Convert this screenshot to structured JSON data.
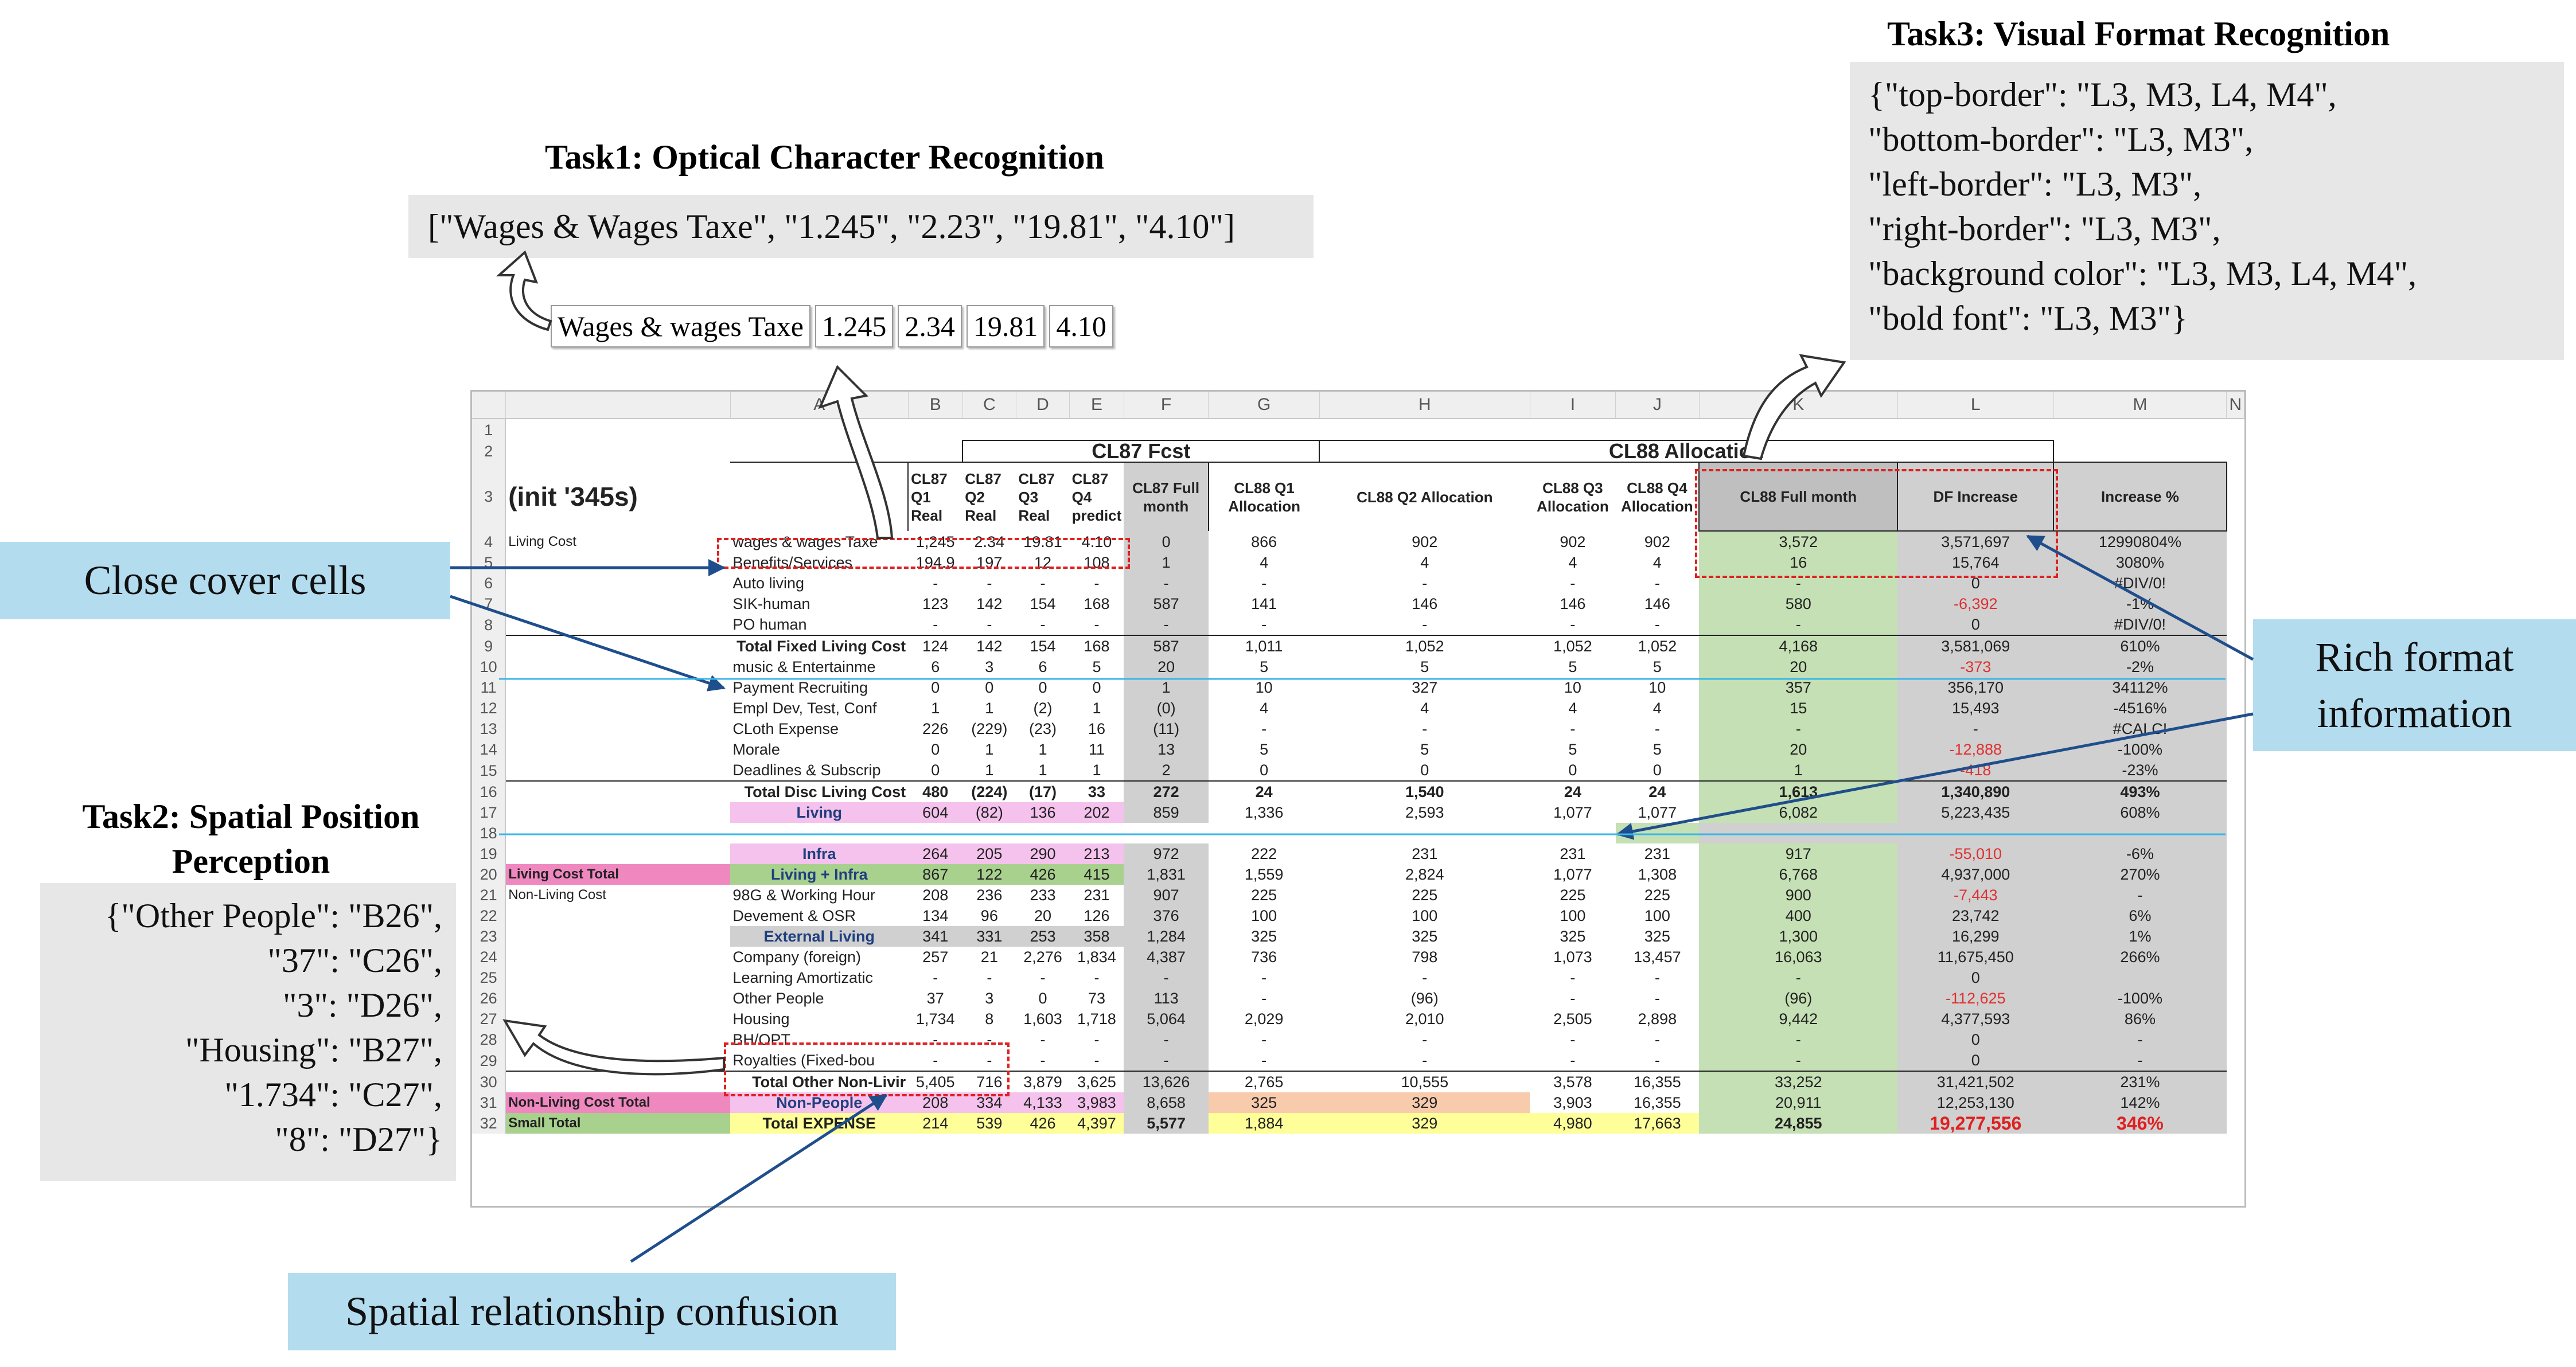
{
  "task1": {
    "title": "Task1: Optical Character Recognition",
    "result": "[\"Wages & Wages Taxe\", \"1.245\", \"2.23\", \"19.81\", \"4.10\"]",
    "crop": [
      "Wages & wages Taxe",
      "1.245",
      "2.34",
      "19.81",
      "4.10"
    ]
  },
  "task2": {
    "title_line1": "Task2: Spatial Position",
    "title_line2": "Perception",
    "lines": [
      "{\"Other People\": \"B26\",",
      "\"37\": \"C26\",",
      "\"3\": \"D26\",",
      "\"Housing\": \"B27\",",
      "\"1.734\": \"C27\",",
      "\"8\": \"D27\"}"
    ]
  },
  "task3": {
    "title": "Task3: Visual Format Recognition",
    "lines": [
      "{\"top-border\": \"L3, M3, L4, M4\",",
      "\"bottom-border\": \"L3, M3\",",
      "\"left-border\": \"L3, M3\",",
      "\"right-border\": \"L3, M3\",",
      "\"background color\": \"L3, M3, L4, M4\",",
      "\"bold font\": \"L3, M3\"}"
    ]
  },
  "callouts": {
    "close_cover": "Close cover cells",
    "rich_format_1": "Rich format",
    "rich_format_2": "information",
    "spatial_confusion": "Spatial relationship confusion"
  },
  "sheet": {
    "columns": [
      "A",
      "B",
      "C",
      "D",
      "E",
      "F",
      "G",
      "H",
      "I",
      "J",
      "K",
      "L",
      "M",
      "N"
    ],
    "title_init": "(init '345s)",
    "cl87_header": "CL87 Fcst",
    "cl88_header": "CL88 Allocation",
    "row3": {
      "c": [
        "CL87",
        "Q1",
        "Real"
      ],
      "d": [
        "CL87",
        "Q2",
        "Real"
      ],
      "e": [
        "CL87",
        "Q3",
        "Real"
      ],
      "f": [
        "CL87",
        "Q4",
        "predict"
      ],
      "g": [
        "CL87 Full",
        "month"
      ],
      "h": [
        "CL88 Q1",
        "Allocation"
      ],
      "i": "CL88 Q2 Allocation",
      "j": [
        "CL88 Q3",
        "Allocation"
      ],
      "k": [
        "CL88 Q4",
        "Allocation"
      ],
      "l": "CL88 Full month",
      "m": "DF Increase",
      "n": "Increase %"
    },
    "rows": [
      {
        "n": "4",
        "a": "Living Cost",
        "b": "wages & wages Taxe",
        "c": "1,245",
        "d": "2.34",
        "e": "19.81",
        "f": "4.10",
        "g": "0",
        "h": "866",
        "i": "902",
        "j": "902",
        "k": "902",
        "l": "3,572",
        "m": "3,571,697",
        "nn": "12990804%"
      },
      {
        "n": "5",
        "a": "",
        "b": "Benefits/Services",
        "c": "194.9",
        "d": "197",
        "e": "12",
        "f": "108",
        "g": "1",
        "h": "4",
        "i": "4",
        "j": "4",
        "k": "4",
        "l": "16",
        "m": "15,764",
        "nn": "3080%"
      },
      {
        "n": "6",
        "a": "",
        "b": "Auto living",
        "c": "-",
        "d": "-",
        "e": "-",
        "f": "-",
        "g": "-",
        "h": "-",
        "i": "-",
        "j": "-",
        "k": "-",
        "l": "-",
        "m": "0",
        "nn": "#DIV/0!"
      },
      {
        "n": "7",
        "a": "",
        "b": "SIK-human",
        "c": "123",
        "d": "142",
        "e": "154",
        "f": "168",
        "g": "587",
        "h": "141",
        "i": "146",
        "j": "146",
        "k": "146",
        "l": "580",
        "m": "-6,392",
        "nn": "-1%",
        "neg": true
      },
      {
        "n": "8",
        "a": "",
        "b": "PO  human",
        "c": "-",
        "d": "-",
        "e": "-",
        "f": "-",
        "g": "-",
        "h": "-",
        "i": "-",
        "j": "-",
        "k": "-",
        "l": "-",
        "m": "0",
        "nn": "#DIV/0!"
      },
      {
        "n": "9",
        "a": "",
        "b": "Total Fixed Living Cost",
        "c": "124",
        "d": "142",
        "e": "154",
        "f": "168",
        "g": "587",
        "h": "1,011",
        "i": "1,052",
        "j": "1,052",
        "k": "1,052",
        "l": "4,168",
        "m": "3,581,069",
        "nn": "610%",
        "total": true
      },
      {
        "n": "10",
        "a": "",
        "b": "music & Entertainme",
        "c": "6",
        "d": "3",
        "e": "6",
        "f": "5",
        "g": "20",
        "h": "5",
        "i": "5",
        "j": "5",
        "k": "5",
        "l": "20",
        "m": "-373",
        "nn": "-2%",
        "neg": true
      },
      {
        "n": "11",
        "a": "",
        "b": "Payment Recruiting",
        "c": "0",
        "d": "0",
        "e": "0",
        "f": "0",
        "g": "1",
        "h": "10",
        "i": "327",
        "j": "10",
        "k": "10",
        "l": "357",
        "m": "356,170",
        "nn": "34112%"
      },
      {
        "n": "12",
        "a": "",
        "b": "Empl Dev, Test, Conf",
        "c": "1",
        "d": "1",
        "e": "(2)",
        "f": "1",
        "g": "(0)",
        "h": "4",
        "i": "4",
        "j": "4",
        "k": "4",
        "l": "15",
        "m": "15,493",
        "nn": "-4516%"
      },
      {
        "n": "13",
        "a": "",
        "b": "CLoth Expense",
        "c": "226",
        "d": "(229)",
        "e": "(23)",
        "f": "16",
        "g": "(11)",
        "h": "-",
        "i": "-",
        "j": "-",
        "k": "-",
        "l": "-",
        "m": "-",
        "nn": "#CALC!"
      },
      {
        "n": "14",
        "a": "",
        "b": "Morale",
        "c": "0",
        "d": "1",
        "e": "1",
        "f": "11",
        "g": "13",
        "h": "5",
        "i": "5",
        "j": "5",
        "k": "5",
        "l": "20",
        "m": "-12,888",
        "nn": "-100%",
        "neg": true
      },
      {
        "n": "15",
        "a": "",
        "b": "Deadlines & Subscrip",
        "c": "0",
        "d": "1",
        "e": "1",
        "f": "1",
        "g": "2",
        "h": "0",
        "i": "0",
        "j": "0",
        "k": "0",
        "l": "1",
        "m": "-418",
        "nn": "-23%",
        "neg": true
      },
      {
        "n": "16",
        "a": "",
        "b": "Total Disc Living Cost",
        "c": "480",
        "d": "(224)",
        "e": "(17)",
        "f": "33",
        "g": "272",
        "h": "24",
        "i": "1,540",
        "j": "24",
        "k": "24",
        "l": "1,613",
        "m": "1,340,890",
        "nn": "493%",
        "total": true,
        "boldnums": true
      },
      {
        "n": "17",
        "a": "",
        "b": "Living",
        "c": "604",
        "d": "(82)",
        "e": "136",
        "f": "202",
        "g": "859",
        "h": "1,336",
        "i": "2,593",
        "j": "1,077",
        "k": "1,077",
        "l": "6,082",
        "m": "5,223,435",
        "nn": "608%",
        "pink": true
      },
      {
        "n": "18",
        "blank": true
      },
      {
        "n": "19",
        "a": "",
        "b": "Infra",
        "c": "264",
        "d": "205",
        "e": "290",
        "f": "213",
        "g": "972",
        "h": "222",
        "i": "231",
        "j": "231",
        "k": "231",
        "l": "917",
        "m": "-55,010",
        "nn": "-6%",
        "pink": true,
        "neg": true
      },
      {
        "n": "20",
        "a": "Living Cost Total",
        "b": "Living + Infra",
        "c": "867",
        "d": "122",
        "e": "426",
        "f": "415",
        "g": "1,831",
        "h": "1,559",
        "i": "2,824",
        "j": "1,077",
        "k": "1,308",
        "l": "6,768",
        "m": "4,937,000",
        "nn": "270%",
        "greenrow": true
      },
      {
        "n": "21",
        "a": "Non-Living Cost",
        "b": "98G & Working Hour",
        "c": "208",
        "d": "236",
        "e": "233",
        "f": "231",
        "g": "907",
        "h": "225",
        "i": "225",
        "j": "225",
        "k": "225",
        "l": "900",
        "m": "-7,443",
        "nn": "-",
        "neg": true
      },
      {
        "n": "22",
        "a": "",
        "b": "Devement & OSR",
        "c": "134",
        "d": "96",
        "e": "20",
        "f": "126",
        "g": "376",
        "h": "100",
        "i": "100",
        "j": "100",
        "k": "100",
        "l": "400",
        "m": "23,742",
        "nn": "6%"
      },
      {
        "n": "23",
        "a": "",
        "b": "External Living",
        "c": "341",
        "d": "331",
        "e": "253",
        "f": "358",
        "g": "1,284",
        "h": "325",
        "i": "325",
        "j": "325",
        "k": "325",
        "l": "1,300",
        "m": "16,299",
        "nn": "1%",
        "grayrow": true
      },
      {
        "n": "24",
        "a": "",
        "b": "Company (foreign)",
        "c": "257",
        "d": "21",
        "e": "2,276",
        "f": "1,834",
        "g": "4,387",
        "h": "736",
        "i": "798",
        "j": "1,073",
        "k": "13,457",
        "l": "16,063",
        "m": "11,675,450",
        "nn": "266%"
      },
      {
        "n": "25",
        "a": "",
        "b": "Learning Amortizatic",
        "c": "-",
        "d": "-",
        "e": "-",
        "f": "-",
        "g": "-",
        "h": "-",
        "i": "-",
        "j": "-",
        "k": "-",
        "l": "-",
        "m": "0",
        "nn": ""
      },
      {
        "n": "26",
        "a": "",
        "b": "Other People",
        "c": "37",
        "d": "3",
        "e": "0",
        "f": "73",
        "g": "113",
        "h": "-",
        "i": "(96)",
        "j": "-",
        "k": "-",
        "l": "(96)",
        "m": "-112,625",
        "nn": "-100%",
        "neg": true
      },
      {
        "n": "27",
        "a": "",
        "b": "Housing",
        "c": "1,734",
        "d": "8",
        "e": "1,603",
        "f": "1,718",
        "g": "5,064",
        "h": "2,029",
        "i": "2,010",
        "j": "2,505",
        "k": "2,898",
        "l": "9,442",
        "m": "4,377,593",
        "nn": "86%"
      },
      {
        "n": "28",
        "a": "",
        "b": "BH/OPT",
        "c": "-",
        "d": "-",
        "e": "-",
        "f": "-",
        "g": "-",
        "h": "-",
        "i": "-",
        "j": "-",
        "k": "-",
        "l": "-",
        "m": "0",
        "nn": "-"
      },
      {
        "n": "29",
        "a": "",
        "b": "Royalties (Fixed-bou",
        "c": "-",
        "d": "-",
        "e": "-",
        "f": "-",
        "g": "-",
        "h": "-",
        "i": "-",
        "j": "-",
        "k": "-",
        "l": "-",
        "m": "0",
        "nn": "-"
      },
      {
        "n": "30",
        "a": "",
        "b": "Total Other Non-Livir",
        "c": "5,405",
        "d": "716",
        "e": "3,879",
        "f": "3,625",
        "g": "13,626",
        "h": "2,765",
        "i": "10,555",
        "j": "3,578",
        "k": "16,355",
        "l": "33,252",
        "m": "31,421,502",
        "nn": "231%",
        "total": true
      },
      {
        "n": "31",
        "a": "Non-Living Cost Total",
        "b": "Non-People",
        "c": "208",
        "d": "334",
        "e": "4,133",
        "f": "3,983",
        "g": "8,658",
        "h": "325",
        "i": "329",
        "j": "3,903",
        "k": "16,355",
        "l": "20,911",
        "m": "12,253,130",
        "nn": "142%",
        "orangerow": true
      },
      {
        "n": "32",
        "a": "Small Total",
        "b": "Total EXPENSE",
        "c": "214",
        "d": "539",
        "e": "426",
        "f": "4,397",
        "g": "5,577",
        "h": "1,884",
        "i": "329",
        "j": "4,980",
        "k": "17,663",
        "l": "24,855",
        "m": "19,277,556",
        "nn": "346%",
        "yellowrow": true
      }
    ]
  },
  "colors": {
    "green": "#c5e0b4",
    "gray": "#d0d0d0",
    "blue_callout": "#b4dcef",
    "red": "#e02020",
    "pink": "#f4c2ec"
  }
}
